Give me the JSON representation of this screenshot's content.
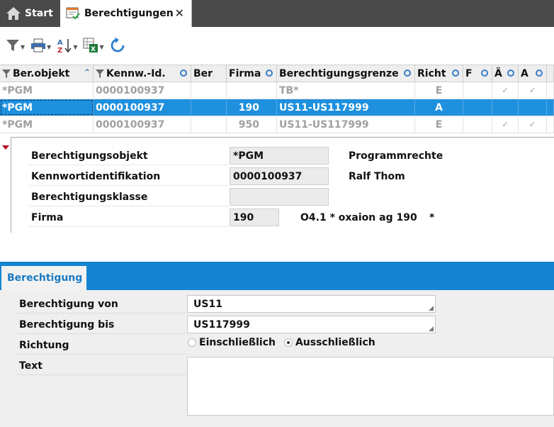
{
  "tabs": {
    "start_label": "Start",
    "active_label": "Berechtigungen",
    "close_glyph": "✕"
  },
  "toolbar": {
    "icons": [
      "filter-icon",
      "print-icon",
      "sort-az-icon",
      "excel-export-icon",
      "refresh-icon"
    ]
  },
  "grid": {
    "headers": [
      "Ber.objekt",
      "Kennw.-Id.",
      "Ber",
      "Firma",
      "Berechtigungsgrenze",
      "Richt",
      "F",
      "Ä",
      "A",
      ""
    ],
    "rows": [
      {
        "objekt": "*PGM",
        "kennw": "0000100937",
        "ber": "",
        "firma": "",
        "grenze": "TB*",
        "richt": "E",
        "f": "",
        "ae": "✓",
        "a": "✓",
        "selected": false
      },
      {
        "objekt": "*PGM",
        "kennw": "0000100937",
        "ber": "",
        "firma": "190",
        "grenze": "US11-US117999",
        "richt": "A",
        "f": "",
        "ae": "",
        "a": "",
        "selected": true
      },
      {
        "objekt": "*PGM",
        "kennw": "0000100937",
        "ber": "",
        "firma": "950",
        "grenze": "US11-US117999",
        "richt": "E",
        "f": "",
        "ae": "✓",
        "a": "✓",
        "selected": false
      }
    ]
  },
  "detail": {
    "objekt_label": "Berechtigungsobjekt",
    "objekt_value": "*PGM",
    "objekt_desc": "Programmrechte",
    "kennw_label": "Kennwortidentifikation",
    "kennw_value": "0000100937",
    "kennw_desc": "Ralf Thom",
    "klasse_label": "Berechtigungsklasse",
    "klasse_value": "",
    "firma_label": "Firma",
    "firma_value": "190",
    "firma_desc": "O4.1 * oxaion ag 190",
    "firma_star": "*"
  },
  "berechtigung": {
    "tab_label": "Berechtigung",
    "von_label": "Berechtigung von",
    "von_value": "US11",
    "bis_label": "Berechtigung bis",
    "bis_value": "US117999",
    "richtung_label": "Richtung",
    "option_ein": "Einschließlich",
    "option_aus": "Ausschließlich",
    "selected_option": "Ausschließlich",
    "text_label": "Text",
    "text_value": ""
  },
  "colors": {
    "accent": "#1e90de",
    "tabbar": "#4a4a4a",
    "section_bar": "#1585d2",
    "tab_text": "#1a7ac2"
  }
}
